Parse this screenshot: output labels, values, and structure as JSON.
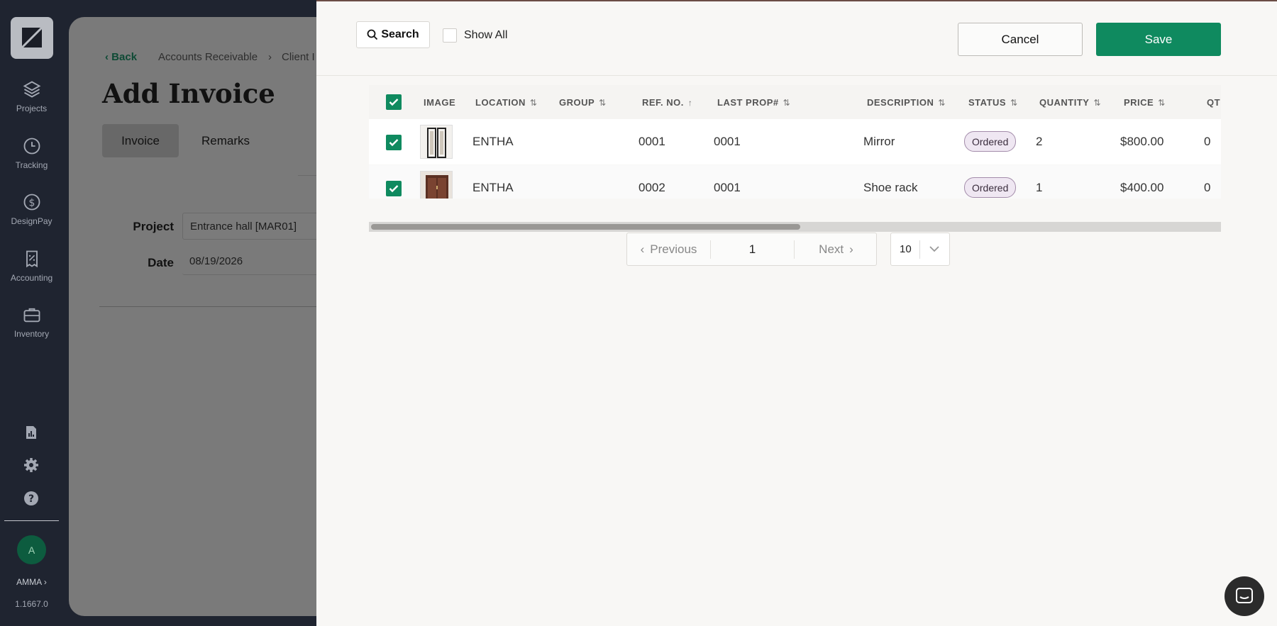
{
  "nav": {
    "items": [
      {
        "label": "Projects",
        "icon": "layers-icon"
      },
      {
        "label": "Tracking",
        "icon": "clock-icon"
      },
      {
        "label": "DesignPay",
        "icon": "dollar-circle-icon"
      },
      {
        "label": "Accounting",
        "icon": "receipt-icon"
      },
      {
        "label": "Inventory",
        "icon": "briefcase-icon"
      }
    ],
    "user_initial": "A",
    "user_name": "AMMA",
    "version": "1.1667.0"
  },
  "background_page": {
    "back_label": "Back",
    "breadcrumb": [
      "Accounts Receivable",
      "Client I"
    ],
    "title": "Add Invoice",
    "tabs": [
      "Invoice",
      "Remarks"
    ],
    "project_label": "Project",
    "project_value": "Entrance hall [MAR01]",
    "date_label": "Date",
    "date_value": "08/19/2026"
  },
  "panel": {
    "search_label": "Search",
    "show_all_label": "Show All",
    "cancel_label": "Cancel",
    "save_label": "Save"
  },
  "table": {
    "columns": [
      "IMAGE",
      "LOCATION",
      "GROUP",
      "REF. NO.",
      "LAST PROP#",
      "DESCRIPTION",
      "STATUS",
      "QUANTITY",
      "PRICE",
      "QT"
    ],
    "rows": [
      {
        "location": "ENTHA",
        "group": "",
        "ref_no": "0001",
        "last_prop": "0001",
        "description": "Mirror",
        "status": "Ordered",
        "quantity": "2",
        "price": "$800.00",
        "qt": "0",
        "image": "mirror-thumbnail"
      },
      {
        "location": "ENTHA",
        "group": "",
        "ref_no": "0002",
        "last_prop": "0001",
        "description": "Shoe rack",
        "status": "Ordered",
        "quantity": "1",
        "price": "$400.00",
        "qt": "0",
        "image": "shoe-rack-thumbnail"
      }
    ]
  },
  "pagination": {
    "previous_label": "Previous",
    "page": "1",
    "next_label": "Next",
    "page_size": "10"
  },
  "colors": {
    "accent": "#0f8a5f",
    "sidebar": "#1f2430"
  }
}
